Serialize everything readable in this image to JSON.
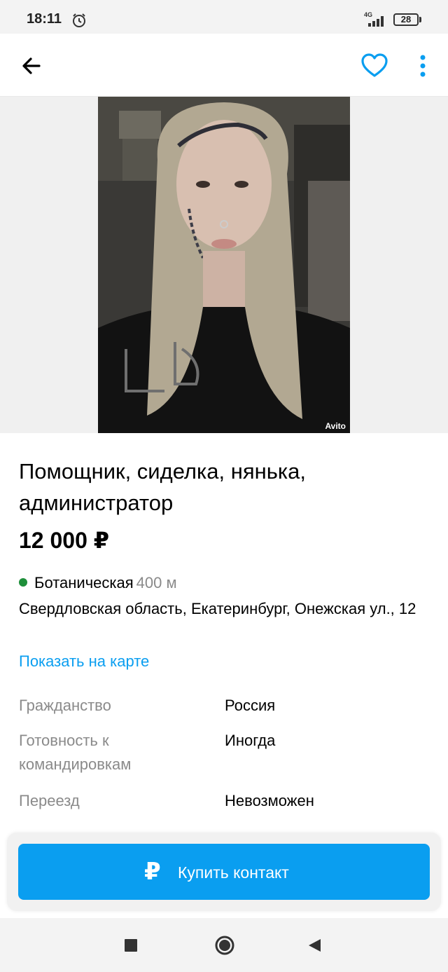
{
  "status_bar": {
    "time": "18:11",
    "network": "4G",
    "battery": "28"
  },
  "toolbar": {
    "back_icon": "arrow-left-icon",
    "favorite_icon": "heart-outline-icon",
    "more_icon": "more-vertical-icon"
  },
  "gallery": {
    "watermark": "Avito"
  },
  "listing": {
    "title": "Помощник, сиделка, нянька, администратор",
    "price": "12 000 ₽",
    "metro": {
      "station": "Ботаническая",
      "distance": "400 м",
      "line_color": "#1e8f3a"
    },
    "address": "Свердловская область, Екатеринбург, Онежская ул., 12",
    "map_link": "Показать на карте",
    "params": [
      {
        "key": "Гражданство",
        "value": "Россия"
      },
      {
        "key": "Готовность к командировкам",
        "value": "Иногда"
      },
      {
        "key": "Переезд",
        "value": "Невозможен"
      }
    ]
  },
  "action": {
    "buy_contact_label": "Купить контакт",
    "buy_contact_icon": "₽"
  },
  "colors": {
    "accent": "#0a9ef0",
    "link": "#0a9ef0"
  }
}
